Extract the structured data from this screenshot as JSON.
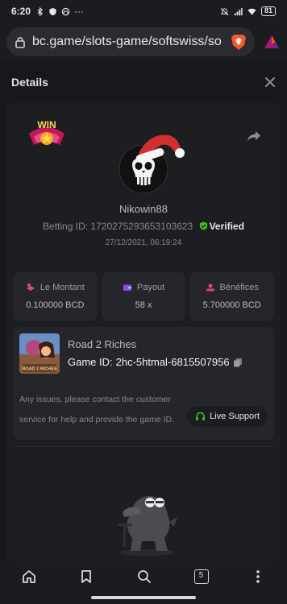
{
  "statusbar": {
    "time": "6:20",
    "dots": "···",
    "battery": "81"
  },
  "browser": {
    "url": "bc.game/slots-game/softswiss/so"
  },
  "details": {
    "title": "Details",
    "win_badge": "WIN",
    "username": "Nikowin88",
    "betting_label": "Betting ID: ",
    "betting_id": "1720275293653103623",
    "verified": "Verified",
    "date": "27/12/2021, 06:19:24",
    "stats": [
      {
        "label": "Le Montant",
        "value": "0.100000 BCD",
        "icon": "money-icon",
        "color": "#e2496a"
      },
      {
        "label": "Payout",
        "value": "58 x",
        "icon": "wallet-icon",
        "color": "#8b4fe0"
      },
      {
        "label": "Bénéfices",
        "value": "5.700000 BCD",
        "icon": "coins-icon",
        "color": "#e2496a"
      }
    ],
    "game": {
      "name": "Road 2 Riches",
      "id_label": "Game ID:",
      "id": "2hc-5htmal-6815507956",
      "thumb_text": "ROAD 2 RICHES"
    },
    "help_text": "Any issues, please contact the customer service for help and provide the game ID.",
    "live_support": "Live Support"
  },
  "nav": {
    "tabs_count": "5"
  },
  "colors": {
    "verified": "#3bc117",
    "accent": "#3bc117"
  }
}
